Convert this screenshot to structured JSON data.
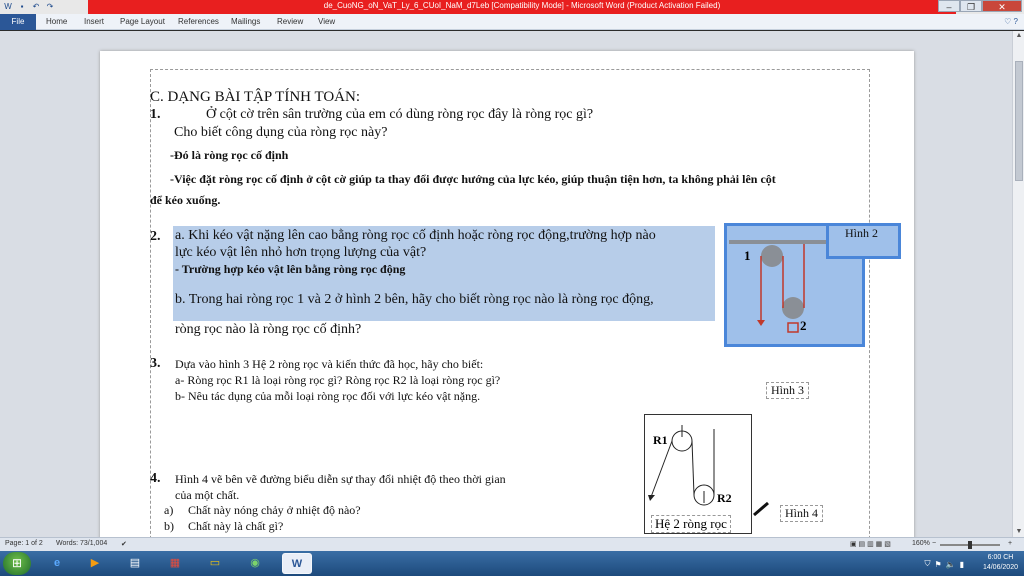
{
  "window": {
    "title": "de_CuoNG_oN_VaT_Ly_6_CUoI_NaM_d7Leb [Compatibility Mode] - Microsoft Word (Product Activation Failed)"
  },
  "ribbon": {
    "file": "File",
    "tabs": [
      "Home",
      "Insert",
      "Page Layout",
      "References",
      "Mailings",
      "Review",
      "View"
    ]
  },
  "document": {
    "heading": "C. DẠNG BÀI TẬP TÍNH TOÁN:",
    "q1": {
      "num": "1.",
      "line1": "Ở cột cờ trên sân trường của em có dùng ròng rọc  đây là ròng rọc gì?",
      "line2": "Cho biết công dụng của ròng rọc này?",
      "answer1": "-Đó là ròng rọc cố định",
      "answer2a": "-Việc đặt ròng rọc cố định ở cột cờ giúp ta thay đổi được hướng của lực kéo, giúp thuận tiện hơn, ta không phải lên cột",
      "answer2b": "để kéo xuống."
    },
    "q2": {
      "num": "2.",
      "a_line1": "a. Khi kéo vật nặng lên cao bằng ròng rọc cố định hoặc ròng rọc động,trường hợp nào",
      "a_line2": "lực kéo vật lên nhỏ hơn trọng lượng của vật?",
      "answer": "- Trường hợp kéo vật lên bằng ròng rọc động",
      "b_line1": "b. Trong hai ròng rọc 1 và 2 ở hình 2 bên, hãy cho biết ròng rọc nào là ròng rọc động,",
      "b_line2": "ròng rọc nào là ròng rọc cố định?"
    },
    "q3": {
      "num": "3.",
      "line1": "Dựa vào hình 3 Hệ 2 ròng rọc và  kiến thức đã học, hãy cho biết:",
      "line2": "a- Ròng rọc R1 là loại ròng rọc gì? Ròng rọc R2 là loại ròng rọc gì?",
      "line3": "b- Nêu tác dụng của mỗi loại ròng rọc đối với lực  kéo vật nặng."
    },
    "q4": {
      "num": "4.",
      "line1": "Hình 4 vẽ bên vẽ đường biểu diễn sự thay đổi nhiệt độ theo thời gian",
      "line2": "của một chất.",
      "a_marker": "a)",
      "a": "Chất này nóng chảy ở nhiệt độ nào?",
      "b_marker": "b)",
      "b": "Chất này là chất gì?"
    },
    "figures": {
      "fig2_label": "Hình 2",
      "fig2_pulley1": "1",
      "fig2_pulley2": "2",
      "fig3_label": "Hình 3",
      "fig3_r1": "R1",
      "fig3_r2": "R2",
      "fig3_caption": "Hệ 2 ròng rọc",
      "fig4_label": "Hình 4"
    }
  },
  "statusbar": {
    "page": "Page: 1 of 2",
    "words": "Words: 73/1,004",
    "zoom": "160%"
  },
  "taskbar": {
    "time": "6:00 CH",
    "date": "14/06/2020"
  },
  "colors": {
    "title_red": "#e81f1f",
    "selection": "#b7cde9",
    "figure_selection": "#4a86d9",
    "file_tab": "#2b5797"
  }
}
